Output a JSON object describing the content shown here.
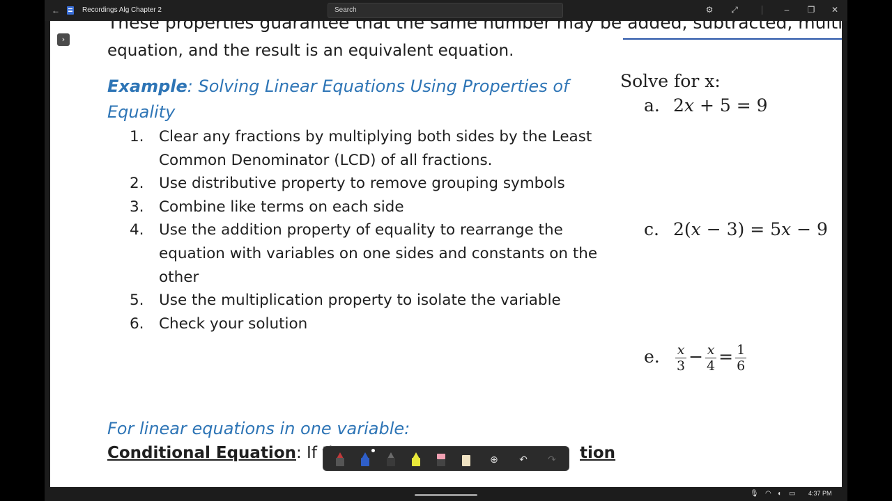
{
  "window": {
    "title": "Recordings Alg Chapter 2",
    "search_label": "Search",
    "icons": {
      "back": "back-arrow-icon",
      "app": "notes-app-icon",
      "settings": "gear-icon",
      "expand": "expand-icon",
      "minimize": "minimize-icon",
      "restore": "restore-icon",
      "close": "close-icon"
    }
  },
  "slide": {
    "intro_line1": "These properties guarantee that the same number may be added, subtracted, multipl",
    "intro_line2": "equation, and the result is an equivalent equation.",
    "example_label": "Example",
    "example_title": ": Solving Linear Equations Using Properties of Equality",
    "steps": [
      {
        "num": "1.",
        "text": "Clear any fractions by multiplying both sides by the Least Common Denominator (LCD) of all fractions."
      },
      {
        "num": "2.",
        "text": "Use distributive property to remove grouping symbols"
      },
      {
        "num": "3.",
        "text": "Combine like terms on each side"
      },
      {
        "num": "4.",
        "text": "Use the addition property of equality to rearrange the equation with variables on one sides and constants on the other"
      },
      {
        "num": "5.",
        "text": "Use the multiplication property to isolate the variable"
      },
      {
        "num": "6.",
        "text": "Check your solution"
      }
    ],
    "solve_heading": "Solve for x:",
    "problems": {
      "a": {
        "label": "a.",
        "part1": "2",
        "var": "x",
        "part2": " + 5 = 9"
      },
      "c": {
        "label": "c.",
        "part1": "2(",
        "var": "x",
        "part2": " − 3) = 5",
        "var2": "x",
        "part3": " − 9"
      },
      "e": {
        "label": "e.",
        "num1": "x",
        "den1": "3",
        "op": "−",
        "num2": "x",
        "den2": "4",
        "eq": "=",
        "num3": "1",
        "den3": "6"
      }
    },
    "linear_heading": "For linear equations in one variable:",
    "conditional_term": "Conditional Equation",
    "conditional_rest": ": If the",
    "conditional_tail": "tion"
  },
  "ink_toolbar": {
    "tools": [
      "red-pen",
      "blue-pen",
      "pencil",
      "highlighter",
      "eraser",
      "ruler"
    ],
    "colors": {
      "red": "#c0393b",
      "blue": "#2f5fc9",
      "gray": "#6b6b6b",
      "yellow": "#e9e93a",
      "pink": "#f2a1b3",
      "beige": "#efe2c2"
    }
  },
  "taskbar": {
    "time": "4:37 PM"
  },
  "colors": {
    "accent_blue": "#2e75b6",
    "titlebar": "#1f1f1f"
  }
}
